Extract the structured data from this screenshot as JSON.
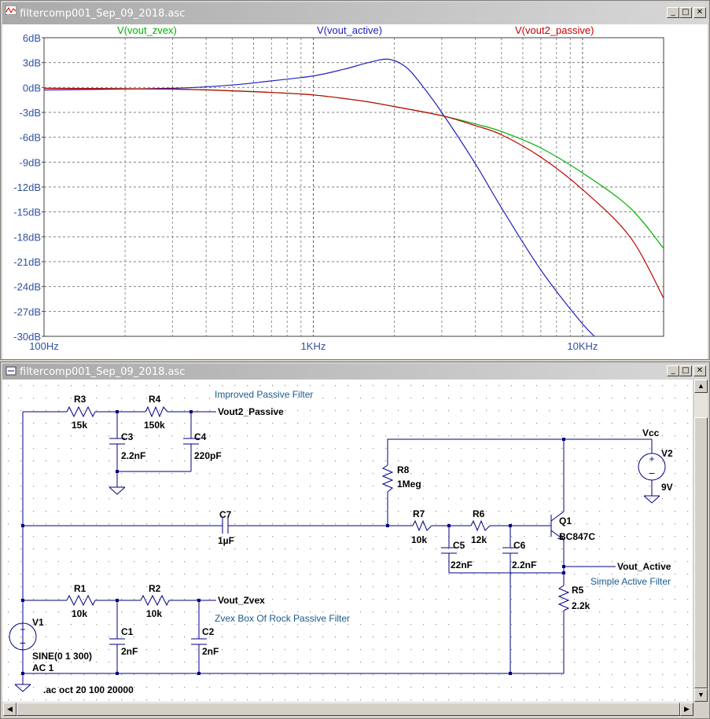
{
  "plot_window": {
    "title": "filtercomp001_Sep_09_2018.asc",
    "legend": [
      "V(vout_zvex)",
      "V(vout_active)",
      "V(vout2_passive)"
    ],
    "y_ticks": [
      "6dB",
      "3dB",
      "0dB",
      "-3dB",
      "-6dB",
      "-9dB",
      "-12dB",
      "-15dB",
      "-18dB",
      "-21dB",
      "-24dB",
      "-27dB",
      "-30dB"
    ],
    "x_ticks": [
      "100Hz",
      "1KHz",
      "10KHz"
    ]
  },
  "schematic_window": {
    "title": "filtercomp001_Sep_09_2018.asc",
    "labels": {
      "improved": "Improved Passive Filter",
      "zvex": "Zvex Box Of Rock Passive Filter",
      "active": "Simple Active Filter",
      "vout2": "Vout2_Passive",
      "vout_zvex": "Vout_Zvex",
      "vout_active": "Vout_Active",
      "vcc": "Vcc",
      "directive": ".ac oct 20 100 20000"
    },
    "components": {
      "R3": {
        "name": "R3",
        "value": "15k"
      },
      "R4": {
        "name": "R4",
        "value": "150k"
      },
      "C3": {
        "name": "C3",
        "value": "2.2nF"
      },
      "C4": {
        "name": "C4",
        "value": "220pF"
      },
      "C7": {
        "name": "C7",
        "value": "1µF"
      },
      "R8": {
        "name": "R8",
        "value": "1Meg"
      },
      "R7": {
        "name": "R7",
        "value": "10k"
      },
      "R6": {
        "name": "R6",
        "value": "12k"
      },
      "C5": {
        "name": "C5",
        "value": "22nF"
      },
      "C6": {
        "name": "C6",
        "value": "2.2nF"
      },
      "Q1": {
        "name": "Q1",
        "value": "BC847C"
      },
      "R5": {
        "name": "R5",
        "value": "2.2k"
      },
      "V2": {
        "name": "V2",
        "value": "9V"
      },
      "R1": {
        "name": "R1",
        "value": "10k"
      },
      "R2": {
        "name": "R2",
        "value": "10k"
      },
      "C1": {
        "name": "C1",
        "value": "2nF"
      },
      "C2": {
        "name": "C2",
        "value": "2nF"
      },
      "V1": {
        "name": "V1",
        "value": "SINE(0 1 300)",
        "value2": "AC 1"
      }
    }
  },
  "chart_data": {
    "type": "line",
    "xscale": "log",
    "xlim": [
      100,
      20000
    ],
    "ylim": [
      -30,
      6
    ],
    "grid": true,
    "x_ticks": [
      "100Hz",
      "1KHz",
      "10KHz"
    ],
    "series": [
      {
        "name": "V(vout_zvex)",
        "color": "#00b000",
        "x": [
          100,
          300,
          500,
          700,
          1000,
          1500,
          2000,
          3000,
          4000,
          5000,
          7000,
          10000,
          15000,
          20000
        ],
        "y": [
          -0.1,
          -0.2,
          -0.4,
          -0.6,
          -0.9,
          -1.6,
          -2.3,
          -3.4,
          -4.4,
          -5.3,
          -7.3,
          -10.3,
          -14.5,
          -19.4
        ]
      },
      {
        "name": "V(vout_active)",
        "color": "#2020c0",
        "x": [
          100,
          300,
          500,
          700,
          1000,
          1300,
          1600,
          1900,
          2200,
          2500,
          3000,
          4000,
          5000,
          7000,
          10000,
          12000
        ],
        "y": [
          -0.3,
          -0.1,
          0.3,
          0.8,
          1.4,
          2.2,
          3.0,
          3.4,
          2.5,
          0.5,
          -3.0,
          -9.2,
          -14.5,
          -22.0,
          -28.5,
          -31.0
        ]
      },
      {
        "name": "V(vout2_passive)",
        "color": "#c00000",
        "x": [
          100,
          300,
          500,
          700,
          1000,
          1500,
          2000,
          3000,
          4000,
          5000,
          7000,
          10000,
          15000,
          20000
        ],
        "y": [
          -0.1,
          -0.2,
          -0.4,
          -0.6,
          -0.9,
          -1.6,
          -2.3,
          -3.4,
          -4.6,
          -5.7,
          -8.4,
          -12.3,
          -18.0,
          -25.4
        ]
      }
    ]
  }
}
